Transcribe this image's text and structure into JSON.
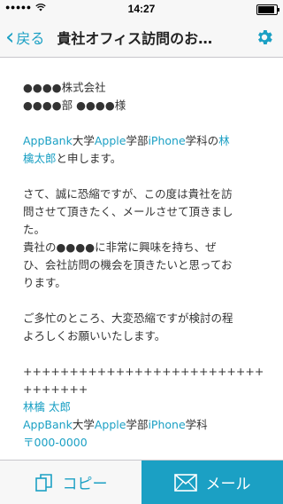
{
  "status": {
    "dots": "●●●●●",
    "time": "14:27",
    "battery_level": 0.9
  },
  "nav": {
    "back_label": "戻る",
    "title": "貴社オフィス訪問のお…"
  },
  "body": {
    "l1": "●●●●株式会社",
    "l2": "●●●●部 ●●●●様",
    "intro_a": "AppBank",
    "intro_b": "大学",
    "intro_c": "Apple",
    "intro_d": "学部",
    "intro_e": "iPhone",
    "intro_f": "学科の",
    "intro_g": "林",
    "intro2_a": "檎太郎",
    "intro2_b": "と申します。",
    "p2": [
      "さて、誠に恐縮ですが、この度は貴社を訪",
      "問させて頂きたく、メールさせて頂きまし",
      "た。",
      "貴社の●●●●に非常に興味を持ち、ぜ",
      "ひ、会社訪問の機会を頂きたいと思ってお",
      "ります。"
    ],
    "p3": [
      "ご多忙のところ、大変恐縮ですが検討の程",
      "よろしくお願いいたします。"
    ],
    "sig1": "++++++++++++++++++++++++++",
    "sig2": "+++++++",
    "sig_name": "林檎 太郎",
    "sig_school_a": "AppBank",
    "sig_school_b": "大学",
    "sig_school_c": "Apple",
    "sig_school_d": "学部",
    "sig_school_e": "iPhone",
    "sig_school_f": "学科",
    "sig_zip": "〒000-0000"
  },
  "toolbar": {
    "copy_label": "コピー",
    "mail_label": "メール"
  },
  "colors": {
    "accent": "#1ba0c4"
  }
}
